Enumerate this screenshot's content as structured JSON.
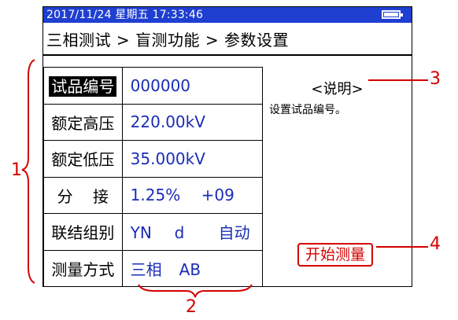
{
  "status_bar": {
    "datetime": "2017/11/24  星期五  17:33:46",
    "battery_icon": "battery-icon"
  },
  "breadcrumb": "三相测试 > 盲测功能 > 参数设置",
  "params": [
    {
      "label": "试品编号",
      "value_a": "000000",
      "value_b": "",
      "value_c": ""
    },
    {
      "label": "额定高压",
      "value_a": "220.00kV",
      "value_b": "",
      "value_c": ""
    },
    {
      "label": "额定低压",
      "value_a": "35.000kV",
      "value_b": "",
      "value_c": ""
    },
    {
      "label": "分    接",
      "value_a": "1.25%",
      "value_b": "+09",
      "value_c": ""
    },
    {
      "label": "联结组别",
      "value_a": "YN",
      "value_b": "d",
      "value_c": "自动"
    },
    {
      "label": "测量方式",
      "value_a": "三相",
      "value_b": "AB",
      "value_c": ""
    }
  ],
  "description": {
    "title": "<说明>",
    "text": "设置试品编号。"
  },
  "start_button": "开始测量",
  "annotations": {
    "n1": "1",
    "n2": "2",
    "n3": "3",
    "n4": "4"
  },
  "colors": {
    "status_bar": "#1f3fd1",
    "value_text": "#1a2db6",
    "annotation": "#d40000"
  }
}
